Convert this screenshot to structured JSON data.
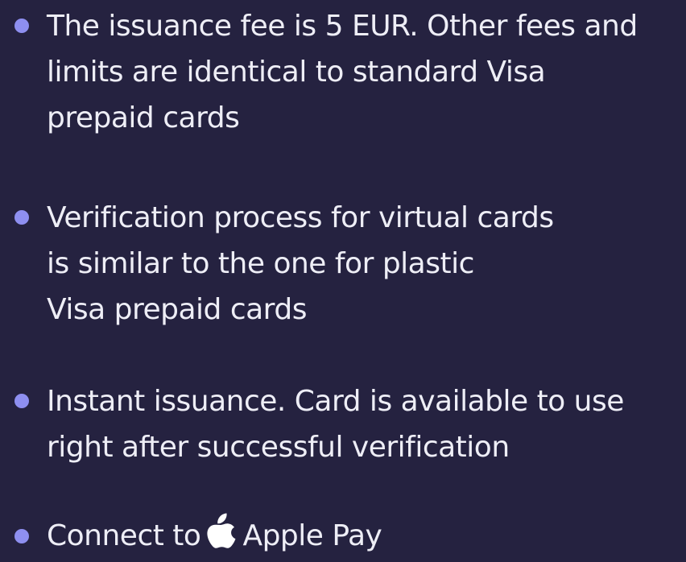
{
  "features": {
    "item1": {
      "lines": [
        "The issuance fee is 5 EUR. Other fees and",
        "limits are identical to standard Visa",
        "prepaid cards"
      ]
    },
    "item2": {
      "lines": [
        "Verification process for virtual cards",
        "is similar to the one for plastic",
        "Visa prepaid cards"
      ]
    },
    "item3": {
      "lines": [
        "Instant issuance. Card is available to use",
        "right after successful verification"
      ]
    },
    "item4": {
      "prefix": "Connect to",
      "icon": "apple-logo-icon",
      "suffix": "Apple Pay"
    }
  },
  "colors": {
    "background": "#252240",
    "text": "#eeeef6",
    "bullet": "#8e8ff0"
  }
}
